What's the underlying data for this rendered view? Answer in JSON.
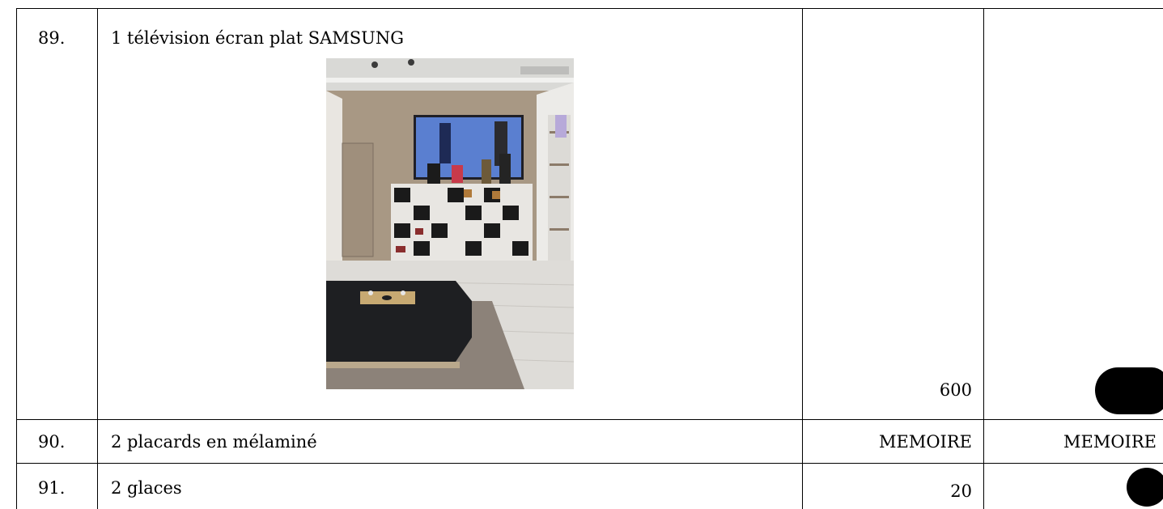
{
  "table": {
    "rows": [
      {
        "number": "89.",
        "description": "1 télévision écran plat SAMSUNG",
        "value1": "600",
        "value2": ""
      },
      {
        "number": "90.",
        "description": "2 placards en mélaminé",
        "value1": "MEMOIRE",
        "value2": "MEMOIRE"
      },
      {
        "number": "91.",
        "description": "2 glaces",
        "value1": "20",
        "value2": ""
      }
    ]
  },
  "colors": {
    "border": "#000000",
    "redaction": "#000000",
    "background": "#ffffff"
  }
}
